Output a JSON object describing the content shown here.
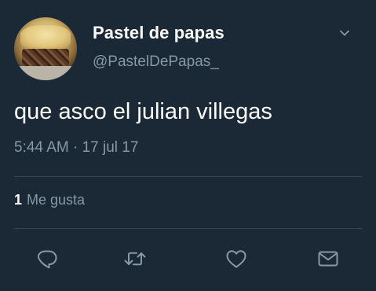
{
  "tweet": {
    "author_name": "Pastel de papas",
    "author_handle": "@PastelDePapas_",
    "text": "que asco el julian villegas",
    "time": "5:44 AM",
    "separator": "·",
    "date": "17 jul 17",
    "likes_count": "1",
    "likes_label": "Me gusta"
  },
  "icons": {
    "menu": "chevron-down-icon",
    "reply": "reply-icon",
    "retweet": "retweet-icon",
    "like": "heart-icon",
    "dm": "envelope-icon"
  },
  "colors": {
    "background": "#1b2836",
    "primary_text": "#ffffff",
    "secondary_text": "#8899a6",
    "divider": "#38444d"
  }
}
